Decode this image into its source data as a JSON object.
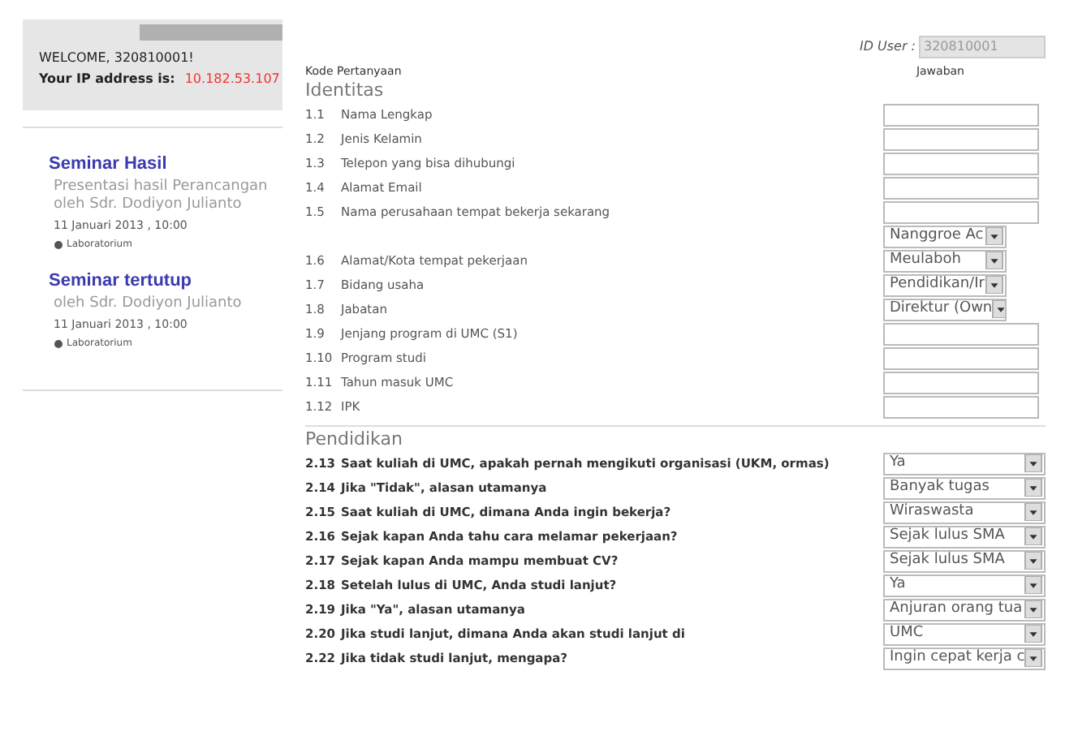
{
  "sidebar": {
    "welcome": "WELCOME, 320810001!",
    "ip_label": "Your IP address is:",
    "ip": "10.182.53.107",
    "events": [
      {
        "title": "Seminar Hasil",
        "description": "Presentasi hasil Perancangan oleh Sdr. Dodiyon Julianto",
        "date": "11 Januari 2013 , 10:00",
        "place": "Laboratorium"
      },
      {
        "title": "Seminar tertutup",
        "description": "oleh Sdr. Dodiyon Julianto",
        "date": "11 Januari 2013 , 10:00",
        "place": "Laboratorium"
      }
    ]
  },
  "user_id": {
    "label": "ID User :",
    "value": "320810001"
  },
  "columns": {
    "code": "Kode Pertanyaan",
    "answer": "Jawaban"
  },
  "sections": [
    {
      "title": "Identitas",
      "rows": [
        {
          "code": "1.1",
          "label": "Nama Lengkap",
          "answers": [
            {
              "kind": "text"
            }
          ]
        },
        {
          "code": "1.2",
          "label": "Jenis Kelamin",
          "answers": [
            {
              "kind": "text"
            }
          ]
        },
        {
          "code": "1.3",
          "label": "Telepon yang bisa dihubungi",
          "answers": [
            {
              "kind": "text"
            }
          ]
        },
        {
          "code": "1.4",
          "label": "Alamat Email",
          "answers": [
            {
              "kind": "text"
            }
          ]
        },
        {
          "code": "1.5",
          "label": "Nama perusahaan tempat bekerja sekarang",
          "answers": [
            {
              "kind": "text"
            }
          ]
        },
        {
          "code": "1.6",
          "label": "Alamat/Kota tempat pekerjaan",
          "answers": [
            {
              "kind": "select",
              "value": "Nanggroe Ac"
            },
            {
              "kind": "select",
              "value": "Meulaboh"
            }
          ]
        },
        {
          "code": "1.7",
          "label": "Bidang usaha",
          "answers": [
            {
              "kind": "select",
              "value": "Pendidikan/Ir"
            }
          ]
        },
        {
          "code": "1.8",
          "label": "Jabatan",
          "answers": [
            {
              "kind": "select",
              "value": "Direktur (Own"
            }
          ]
        },
        {
          "code": "1.9",
          "label": "Jenjang program di UMC (S1)",
          "answers": [
            {
              "kind": "text"
            }
          ]
        },
        {
          "code": "1.10",
          "label": "Program studi",
          "answers": [
            {
              "kind": "text"
            }
          ]
        },
        {
          "code": "1.11",
          "label": "Tahun masuk UMC",
          "answers": [
            {
              "kind": "text"
            }
          ]
        },
        {
          "code": "1.12",
          "label": "IPK",
          "answers": [
            {
              "kind": "text"
            }
          ]
        }
      ]
    },
    {
      "title": "Pendidikan",
      "rows": [
        {
          "code": "2.13",
          "label": "Saat kuliah di UMC, apakah pernah mengikuti organisasi (UKM, ormas)",
          "answers": [
            {
              "kind": "wide_select",
              "value": "Ya"
            }
          ]
        },
        {
          "code": "2.14",
          "label": "Jika \"Tidak\", alasan utamanya",
          "answers": [
            {
              "kind": "wide_select",
              "value": "Banyak tugas"
            }
          ]
        },
        {
          "code": "2.15",
          "label": "Saat kuliah di UMC, dimana Anda ingin bekerja?",
          "answers": [
            {
              "kind": "wide_select",
              "value": "Wiraswasta"
            }
          ]
        },
        {
          "code": "2.16",
          "label": "Sejak kapan Anda tahu cara melamar pekerjaan?",
          "answers": [
            {
              "kind": "wide_select",
              "value": "Sejak lulus SMA"
            }
          ]
        },
        {
          "code": "2.17",
          "label": "Sejak kapan Anda mampu membuat CV?",
          "answers": [
            {
              "kind": "wide_select",
              "value": "Sejak lulus SMA"
            }
          ]
        },
        {
          "code": "2.18",
          "label": "Setelah lulus di UMC, Anda studi lanjut?",
          "answers": [
            {
              "kind": "wide_select",
              "value": "Ya"
            }
          ]
        },
        {
          "code": "2.19",
          "label": "Jika \"Ya\", alasan utamanya",
          "answers": [
            {
              "kind": "wide_select",
              "value": "Anjuran orang tua"
            }
          ]
        },
        {
          "code": "2.20",
          "label": "Jika studi lanjut, dimana Anda akan studi lanjut di",
          "answers": [
            {
              "kind": "wide_select",
              "value": "UMC"
            }
          ]
        },
        {
          "code": "2.22",
          "label": "Jika tidak studi lanjut, mengapa?",
          "answers": [
            {
              "kind": "wide_select",
              "value": "Ingin cepat kerja c"
            }
          ]
        }
      ]
    }
  ]
}
